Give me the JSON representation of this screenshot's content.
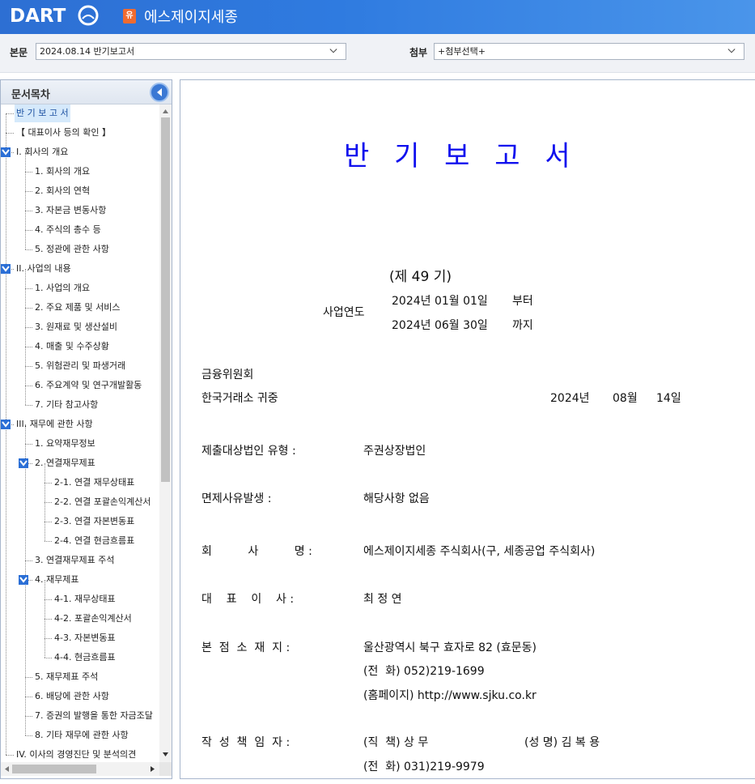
{
  "header": {
    "logo_text": "DART",
    "company_badge": "유",
    "company_name": "에스제이지세종"
  },
  "selector": {
    "body_label": "본문",
    "body_value": "2024.08.14  반기보고서",
    "attach_label": "첨부",
    "attach_value": "+첨부선택+"
  },
  "toc": {
    "title": "문서목차",
    "items": [
      {
        "label": "반 기 보 고 서",
        "level": 0,
        "selected": true
      },
      {
        "label": "【 대표이사 등의 확인 】",
        "level": 0
      },
      {
        "label": "I. 회사의 개요",
        "level": 0,
        "expanded": true
      },
      {
        "label": "1. 회사의 개요",
        "level": 1
      },
      {
        "label": "2. 회사의 연혁",
        "level": 1
      },
      {
        "label": "3. 자본금 변동사항",
        "level": 1
      },
      {
        "label": "4. 주식의 총수 등",
        "level": 1
      },
      {
        "label": "5. 정관에 관한 사항",
        "level": 1
      },
      {
        "label": "II. 사업의 내용",
        "level": 0,
        "expanded": true
      },
      {
        "label": "1. 사업의 개요",
        "level": 1
      },
      {
        "label": "2. 주요 제품 및 서비스",
        "level": 1
      },
      {
        "label": "3. 원재료 및 생산설비",
        "level": 1
      },
      {
        "label": "4. 매출 및 수주상황",
        "level": 1
      },
      {
        "label": "5. 위험관리 및 파생거래",
        "level": 1
      },
      {
        "label": "6. 주요계약 및 연구개발활동",
        "level": 1
      },
      {
        "label": "7. 기타 참고사항",
        "level": 1
      },
      {
        "label": "III. 재무에 관한 사항",
        "level": 0,
        "expanded": true
      },
      {
        "label": "1. 요약재무정보",
        "level": 1
      },
      {
        "label": "2. 연결재무제표",
        "level": 1,
        "expanded": true
      },
      {
        "label": "2-1. 연결 재무상태표",
        "level": 2
      },
      {
        "label": "2-2. 연결 포괄손익계산서",
        "level": 2
      },
      {
        "label": "2-3. 연결 자본변동표",
        "level": 2
      },
      {
        "label": "2-4. 연결 현금흐름표",
        "level": 2
      },
      {
        "label": "3. 연결재무제표 주석",
        "level": 1
      },
      {
        "label": "4. 재무제표",
        "level": 1,
        "expanded": true
      },
      {
        "label": "4-1. 재무상태표",
        "level": 2
      },
      {
        "label": "4-2. 포괄손익계산서",
        "level": 2
      },
      {
        "label": "4-3. 자본변동표",
        "level": 2
      },
      {
        "label": "4-4. 현금흐름표",
        "level": 2
      },
      {
        "label": "5. 재무제표 주석",
        "level": 1
      },
      {
        "label": "6. 배당에 관한 사항",
        "level": 1
      },
      {
        "label": "7. 증권의 발행을 통한 자금조달",
        "level": 1
      },
      {
        "label": "8. 기타 재무에 관한 사항",
        "level": 1
      },
      {
        "label": "IV. 이사의 경영진단 및 분석의견",
        "level": 0
      }
    ]
  },
  "document": {
    "title": "반 기 보 고 서",
    "term": "(제 49 기)",
    "fiscal_year_label": "사업연도",
    "period_start": "2024년 01월 01일",
    "from_word": "부터",
    "period_end": "2024년 06월 30일",
    "to_word": "까지",
    "recipient_1": "금융위원회",
    "recipient_2": "한국거래소 귀중",
    "date_year": "2024년",
    "date_month": "08월",
    "date_day": "14일",
    "fields": [
      {
        "label": "제출대상법인 유형 :",
        "value": "주권상장법인"
      },
      {
        "label": "면제사유발생 :",
        "value": "해당사항 없음"
      },
      {
        "label": "회          사          명 :",
        "value": "에스제이지세종 주식회사(구, 세종공업 주식회사)"
      },
      {
        "label": "대    표    이    사 :",
        "value": "최 정 연"
      },
      {
        "label": "본  점  소  재  지 :",
        "value": "울산광역시 북구 효자로 82 (효문동)"
      },
      {
        "label": "",
        "value": "(전  화) 052)219-1699"
      },
      {
        "label": "",
        "value": "(홈페이지) http://www.sjku.co.kr"
      },
      {
        "label": "작  성  책  임  자 :",
        "value": "(직  책) 상 무"
      },
      {
        "label": "",
        "value": "(전  화) 031)219-9979"
      }
    ],
    "writer_name": "(성  명) 김 복 용"
  }
}
